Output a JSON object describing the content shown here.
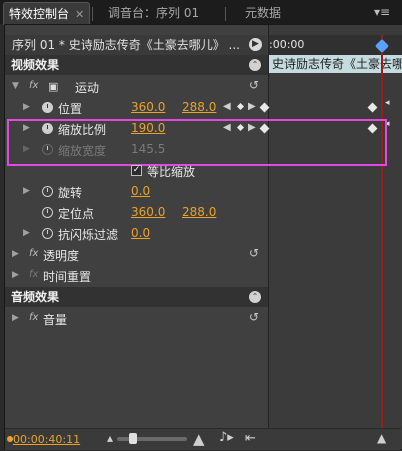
{
  "tabs": {
    "effect_controls": "特效控制台",
    "audio_mixer": "调音台：序列 01",
    "metadata": "元数据"
  },
  "sequence": {
    "name": "序列 01 * 史诗励志传奇《土豪去哪儿》 ...",
    "timecode": ":00:00",
    "clip_name": "史诗励志传奇《土豪去哪儿》"
  },
  "video_effects": {
    "header": "视频效果",
    "motion": {
      "label": "运动",
      "position": {
        "label": "位置",
        "x": "360.0",
        "y": "288.0"
      },
      "scale": {
        "label": "缩放比例",
        "value": "190.0"
      },
      "scale_width": {
        "label": "缩放宽度",
        "value": "145.5"
      },
      "uniform_scale": {
        "label": "等比缩放",
        "checked": true
      },
      "rotation": {
        "label": "旋转",
        "value": "0.0"
      },
      "anchor": {
        "label": "定位点",
        "x": "360.0",
        "y": "288.0"
      },
      "anti_flicker": {
        "label": "抗闪烁过滤",
        "value": "0.0"
      }
    },
    "opacity": {
      "label": "透明度"
    },
    "time_remap": {
      "label": "时间重置"
    }
  },
  "audio_effects": {
    "header": "音频效果",
    "volume": {
      "label": "音量"
    }
  },
  "footer": {
    "timecode": "00:00:40:11"
  },
  "colors": {
    "accent_value": "#e7a32b",
    "highlight_box": "#e14ae0",
    "clip_bg": "#c4dbe0",
    "playhead": "#9a1d1d"
  },
  "icons": [
    "watch-icon",
    "reset-icon",
    "keyframe-diamond-icon",
    "prev-keyframe-icon",
    "next-keyframe-icon",
    "panel-menu-icon"
  ]
}
